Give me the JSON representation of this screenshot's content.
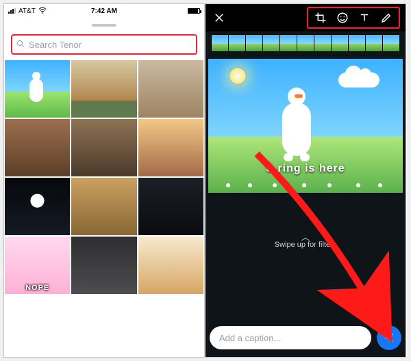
{
  "left": {
    "status": {
      "carrier": "AT&T",
      "time": "7:42 AM"
    },
    "search": {
      "placeholder": "Search Tenor"
    },
    "tiles": [
      {
        "name": "olaf-gif"
      },
      {
        "name": "dog-gif"
      },
      {
        "name": "cat-gif"
      },
      {
        "name": "man-gif"
      },
      {
        "name": "baby-yoda-gif"
      },
      {
        "name": "cat-two-gif"
      },
      {
        "name": "astronaut-gif"
      },
      {
        "name": "capybara-gif"
      },
      {
        "name": "dark-gif"
      },
      {
        "name": "anime-gif",
        "caption": "NOPE"
      },
      {
        "name": "crowd-gif"
      },
      {
        "name": "animal-gif"
      }
    ]
  },
  "right": {
    "preview_caption": "S   ring is here",
    "swipe_hint": "Swipe up for filters",
    "caption": {
      "placeholder": "Add a caption..."
    }
  }
}
